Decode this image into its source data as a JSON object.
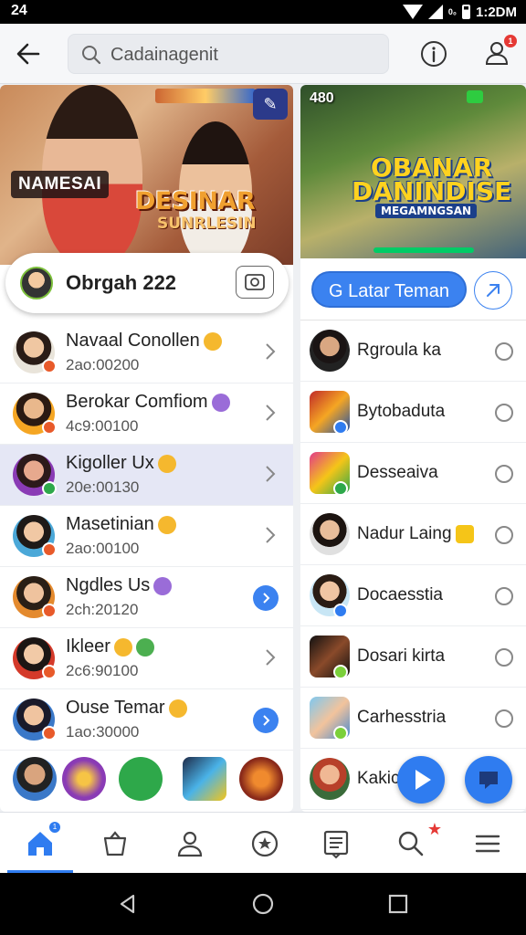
{
  "status_bar": {
    "time": "24",
    "network": "0₀",
    "clock": "1:2DM"
  },
  "search": {
    "placeholder": "Cadainagenit"
  },
  "header": {
    "notification_count": "1"
  },
  "left_banner": {
    "tag": "NAMESAI",
    "title": "DESINAR",
    "subtitle": "SUNRLESIN"
  },
  "right_banner": {
    "count": "480",
    "title_line1": "OBANAR",
    "title_line2": "DANINDISE",
    "subtitle": "MEGAMNGSAN"
  },
  "profile": {
    "name": "Obrgah 222"
  },
  "add_friend_label": "G Latar Teman",
  "left_list": [
    {
      "name": "Navaal Conollen",
      "sub": "2ao:00200",
      "emoji_color": "#f5b82e",
      "dot_color": "#e85a2a",
      "action": "chevron"
    },
    {
      "name": "Berokar Comfiom",
      "sub": "4c9:00100",
      "emoji_color": "#9a6cd8",
      "dot_color": "#e85a2a",
      "action": "chevron"
    },
    {
      "name": "Kigoller Ux",
      "sub": "20e:00130",
      "emoji_color": "#f5b82e",
      "dot_color": "#2ea84a",
      "action": "chevron"
    },
    {
      "name": "Masetinian",
      "sub": "2ao:00100",
      "emoji_color": "#f5b82e",
      "dot_color": "#e85a2a",
      "action": "chevron"
    },
    {
      "name": "Ngdles Us",
      "sub": "2ch:20120",
      "emoji_color": "#9a6cd8",
      "dot_color": "#e85a2a",
      "action": "blue"
    },
    {
      "name": "Ikleer",
      "sub": "2c6:90100",
      "emoji_color": "#f5b82e",
      "dot_color": "#e85a2a",
      "action": "chevron"
    },
    {
      "name": "Ouse Temar",
      "sub": "1ao:30000",
      "emoji_color": "#f5b82e",
      "dot_color": "#e85a2a",
      "action": "blue"
    }
  ],
  "right_list": [
    {
      "name": "Rgroula ka",
      "dot_color": ""
    },
    {
      "name": "Bytobaduta",
      "dot_color": "#2f7cf0"
    },
    {
      "name": "Desseaiva",
      "dot_color": "#2ea84a"
    },
    {
      "name": "Nadur Laing",
      "dot_color": ""
    },
    {
      "name": "Docaesstia",
      "dot_color": "#2f7cf0"
    },
    {
      "name": "Dosari kirta",
      "dot_color": "#7bd03a"
    },
    {
      "name": "Carhesstria",
      "dot_color": "#7bd03a"
    },
    {
      "name": "Kakic",
      "dot_color": ""
    }
  ],
  "colors": {
    "accent": "#2f7cf0",
    "notification": "#e53935"
  }
}
